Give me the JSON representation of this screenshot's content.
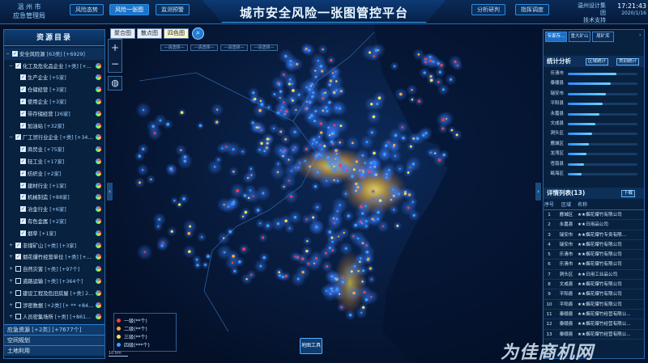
{
  "header": {
    "logo_line1": "温  州  市",
    "logo_line2": "应急管理局",
    "nav_left": [
      "风险态势",
      "风险一张图",
      "监测预警"
    ],
    "nav_right": [
      "分析研判",
      "指挥调度"
    ],
    "title": "城市安全风险一张图管控平台",
    "company_line1": "温州设计集团",
    "company_line2": "技术支持",
    "time": "17:21:43",
    "date": "2020/1/16"
  },
  "left_panel": {
    "title": "资源目录",
    "rows": [
      {
        "level": 0,
        "checked": true,
        "toggle": "−",
        "label": "安全风险源",
        "count": "[63类]  [+6929]"
      },
      {
        "level": 1,
        "checked": true,
        "toggle": "−",
        "label": "化工及危化品企业",
        "count": "[+类]  [+1...",
        "icon": true
      },
      {
        "level": 2,
        "checked": true,
        "label": "生产企业",
        "count": "[+5家]",
        "icon": true
      },
      {
        "level": 2,
        "checked": true,
        "label": "仓储经营",
        "count": "[+3家]",
        "icon": true
      },
      {
        "level": 2,
        "checked": true,
        "label": "使用企业",
        "count": "[+3家]",
        "icon": true
      },
      {
        "level": 2,
        "checked": true,
        "label": "带存储经营",
        "count": "[26家]",
        "icon": true
      },
      {
        "level": 2,
        "checked": true,
        "label": "加油站",
        "count": "[+32家]",
        "icon": true
      },
      {
        "level": 1,
        "checked": true,
        "toggle": "−",
        "label": "厂工贸行业企业",
        "count": "[+类]  [+345家]",
        "icon": true
      },
      {
        "level": 2,
        "checked": true,
        "label": "商贸业",
        "count": "[+75家]",
        "icon": true
      },
      {
        "level": 2,
        "checked": true,
        "label": "轻工业",
        "count": "[+17家]",
        "icon": true
      },
      {
        "level": 2,
        "checked": true,
        "label": "纺织业",
        "count": "[+2家]",
        "icon": true
      },
      {
        "level": 2,
        "checked": true,
        "label": "建材行业",
        "count": "[+1家]",
        "icon": true
      },
      {
        "level": 2,
        "checked": true,
        "label": "机械制造",
        "count": "[+88家]",
        "icon": true
      },
      {
        "level": 2,
        "checked": true,
        "label": "冶金行业",
        "count": "[+6家]",
        "icon": true
      },
      {
        "level": 2,
        "checked": true,
        "label": "有色金属",
        "count": "[+2家]",
        "icon": true
      },
      {
        "level": 2,
        "checked": true,
        "label": "烟草",
        "count": "[+1家]",
        "icon": true
      },
      {
        "level": 1,
        "checked": true,
        "toggle": "+",
        "label": "非煤矿山",
        "count": "[+类]  [+3家]",
        "icon": true
      },
      {
        "level": 1,
        "checked": true,
        "toggle": "+",
        "label": "烟花爆竹经营单位",
        "count": "[+类]  [+3家]",
        "icon": true
      },
      {
        "level": 1,
        "checked": false,
        "toggle": "+",
        "label": "自然灾害",
        "count": "[+类]  [+97个]",
        "icon": true
      },
      {
        "level": 1,
        "checked": false,
        "toggle": "+",
        "label": "道路运输",
        "count": "[+类]  [+364个]",
        "icon": true
      },
      {
        "level": 1,
        "checked": false,
        "toggle": "+",
        "label": "建设工程及危旧房屋",
        "count": "[+类]  2...",
        "icon": true
      },
      {
        "level": 1,
        "checked": false,
        "toggle": "+",
        "label": "涉密数据",
        "count": "[+2类]  [+ ** +846个]",
        "icon": true
      },
      {
        "level": 1,
        "checked": false,
        "toggle": "+",
        "label": "人员密集场所",
        "count": "[+类]  [+861...",
        "icon": true
      }
    ],
    "sections": [
      {
        "label": "应急资源",
        "count": "[+2类]  [+7677个]"
      },
      {
        "label": "空间规划",
        "count": ""
      },
      {
        "label": "土地利用",
        "count": ""
      }
    ]
  },
  "map": {
    "tabs": [
      "聚合图",
      "散点图",
      "四色图"
    ],
    "active_tab": 2,
    "filters": [
      "—请选择—",
      "—请选择—",
      "—请选择—",
      "—请选择—"
    ],
    "legend": [
      {
        "label": "一级(**个)",
        "color": "#ff3b3b"
      },
      {
        "label": "二级(**个)",
        "color": "#ffa53a"
      },
      {
        "label": "三级(**个)",
        "color": "#ffe14a"
      },
      {
        "label": "四级(***个)",
        "color": "#3aa0ff"
      }
    ],
    "map_button": "地图工具",
    "scale": "10 km"
  },
  "right_panel": {
    "tabs": [
      "专家存...",
      "重大矿山",
      "尾矿库"
    ],
    "stats_title": "统计分析",
    "btn_region": "区域统计",
    "btn_type": "类别统计",
    "stats": [
      {
        "label": "乐清市",
        "value": 0.7
      },
      {
        "label": "泰顺县",
        "value": 0.62
      },
      {
        "label": "瑞安市",
        "value": 0.55
      },
      {
        "label": "平阳县",
        "value": 0.5
      },
      {
        "label": "永嘉县",
        "value": 0.45
      },
      {
        "label": "文成县",
        "value": 0.4
      },
      {
        "label": "洞头区",
        "value": 0.35
      },
      {
        "label": "鹿城区",
        "value": 0.3
      },
      {
        "label": "龙湾区",
        "value": 0.27
      },
      {
        "label": "苍南县",
        "value": 0.23
      },
      {
        "label": "瓯海区",
        "value": 0.2
      }
    ],
    "list_title": "详情列表(13)",
    "list_button": "下载",
    "columns": [
      "序号",
      "区域",
      "名称"
    ],
    "rows": [
      [
        "1",
        "鹿城区",
        "★★烟花爆竹有限公司"
      ],
      [
        "2",
        "永嘉县",
        "★★日用品公司"
      ],
      [
        "3",
        "瑞安市",
        "★★烟花爆竹专卖有限..."
      ],
      [
        "4",
        "瑞安市",
        "★★烟花爆竹有限公司"
      ],
      [
        "5",
        "乐清市",
        "★★烟花爆竹有限公司"
      ],
      [
        "6",
        "乐清市",
        "★★烟花爆竹有限公司"
      ],
      [
        "7",
        "洞头区",
        "★★日用工业品公司"
      ],
      [
        "8",
        "文成县",
        "★★烟花爆竹有限公司"
      ],
      [
        "9",
        "平阳县",
        "★★烟花爆竹有限公司"
      ],
      [
        "10",
        "平阳县",
        "★★烟花爆竹有限公司"
      ],
      [
        "11",
        "泰顺县",
        "★★烟花爆竹经营有限公..."
      ],
      [
        "12",
        "泰顺县",
        "★★烟花爆竹经营有限公..."
      ],
      [
        "13",
        "泰顺县",
        "★★烟花爆竹经营有限公..."
      ]
    ]
  },
  "watermark": "为佳商机网"
}
